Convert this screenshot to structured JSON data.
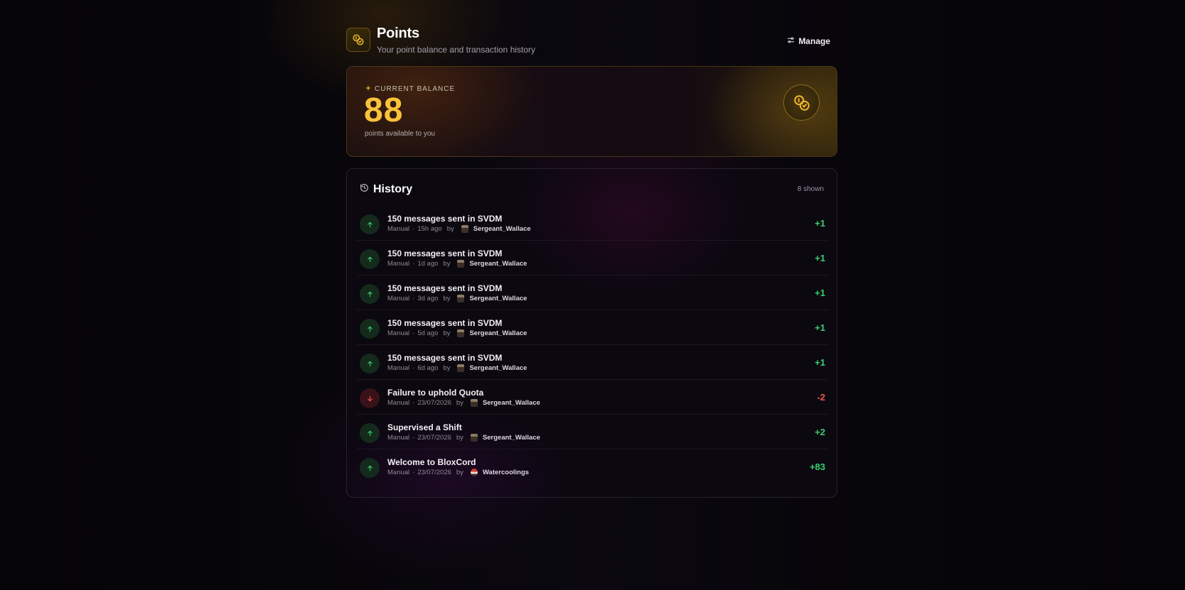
{
  "header": {
    "title": "Points",
    "subtitle": "Your point balance and transaction history",
    "manage_label": "Manage",
    "icon": "coins-icon"
  },
  "balance": {
    "label": "CURRENT BALANCE",
    "value": "88",
    "caption": "points available to you",
    "icon": "coins-icon",
    "accent": "#f9c23a"
  },
  "history": {
    "title": "History",
    "count": "8 shown",
    "icon": "history-icon",
    "by_word": "by",
    "items": [
      {
        "title": "150 messages sent in SVDM",
        "source": "Manual",
        "when": "15h ago",
        "author": "Sergeant_Wallace",
        "avatar": "sgt",
        "delta": "+1",
        "direction": "up"
      },
      {
        "title": "150 messages sent in SVDM",
        "source": "Manual",
        "when": "1d ago",
        "author": "Sergeant_Wallace",
        "avatar": "sgt",
        "delta": "+1",
        "direction": "up"
      },
      {
        "title": "150 messages sent in SVDM",
        "source": "Manual",
        "when": "3d ago",
        "author": "Sergeant_Wallace",
        "avatar": "sgt",
        "delta": "+1",
        "direction": "up"
      },
      {
        "title": "150 messages sent in SVDM",
        "source": "Manual",
        "when": "5d ago",
        "author": "Sergeant_Wallace",
        "avatar": "sgt",
        "delta": "+1",
        "direction": "up"
      },
      {
        "title": "150 messages sent in SVDM",
        "source": "Manual",
        "when": "6d ago",
        "author": "Sergeant_Wallace",
        "avatar": "sgt",
        "delta": "+1",
        "direction": "up"
      },
      {
        "title": "Failure to uphold Quota",
        "source": "Manual",
        "when": "23/07/2026",
        "author": "Sergeant_Wallace",
        "avatar": "sgt",
        "delta": "-2",
        "direction": "down"
      },
      {
        "title": "Supervised a Shift",
        "source": "Manual",
        "when": "23/07/2026",
        "author": "Sergeant_Wallace",
        "avatar": "sgt",
        "delta": "+2",
        "direction": "up"
      },
      {
        "title": "Welcome to BloxCord",
        "source": "Manual",
        "when": "23/07/2026",
        "author": "Watercoolings",
        "avatar": "wc",
        "delta": "+83",
        "direction": "up"
      }
    ]
  },
  "colors": {
    "positive": "#3ad070",
    "negative": "#f0584f",
    "gold": "#f9c23a"
  }
}
